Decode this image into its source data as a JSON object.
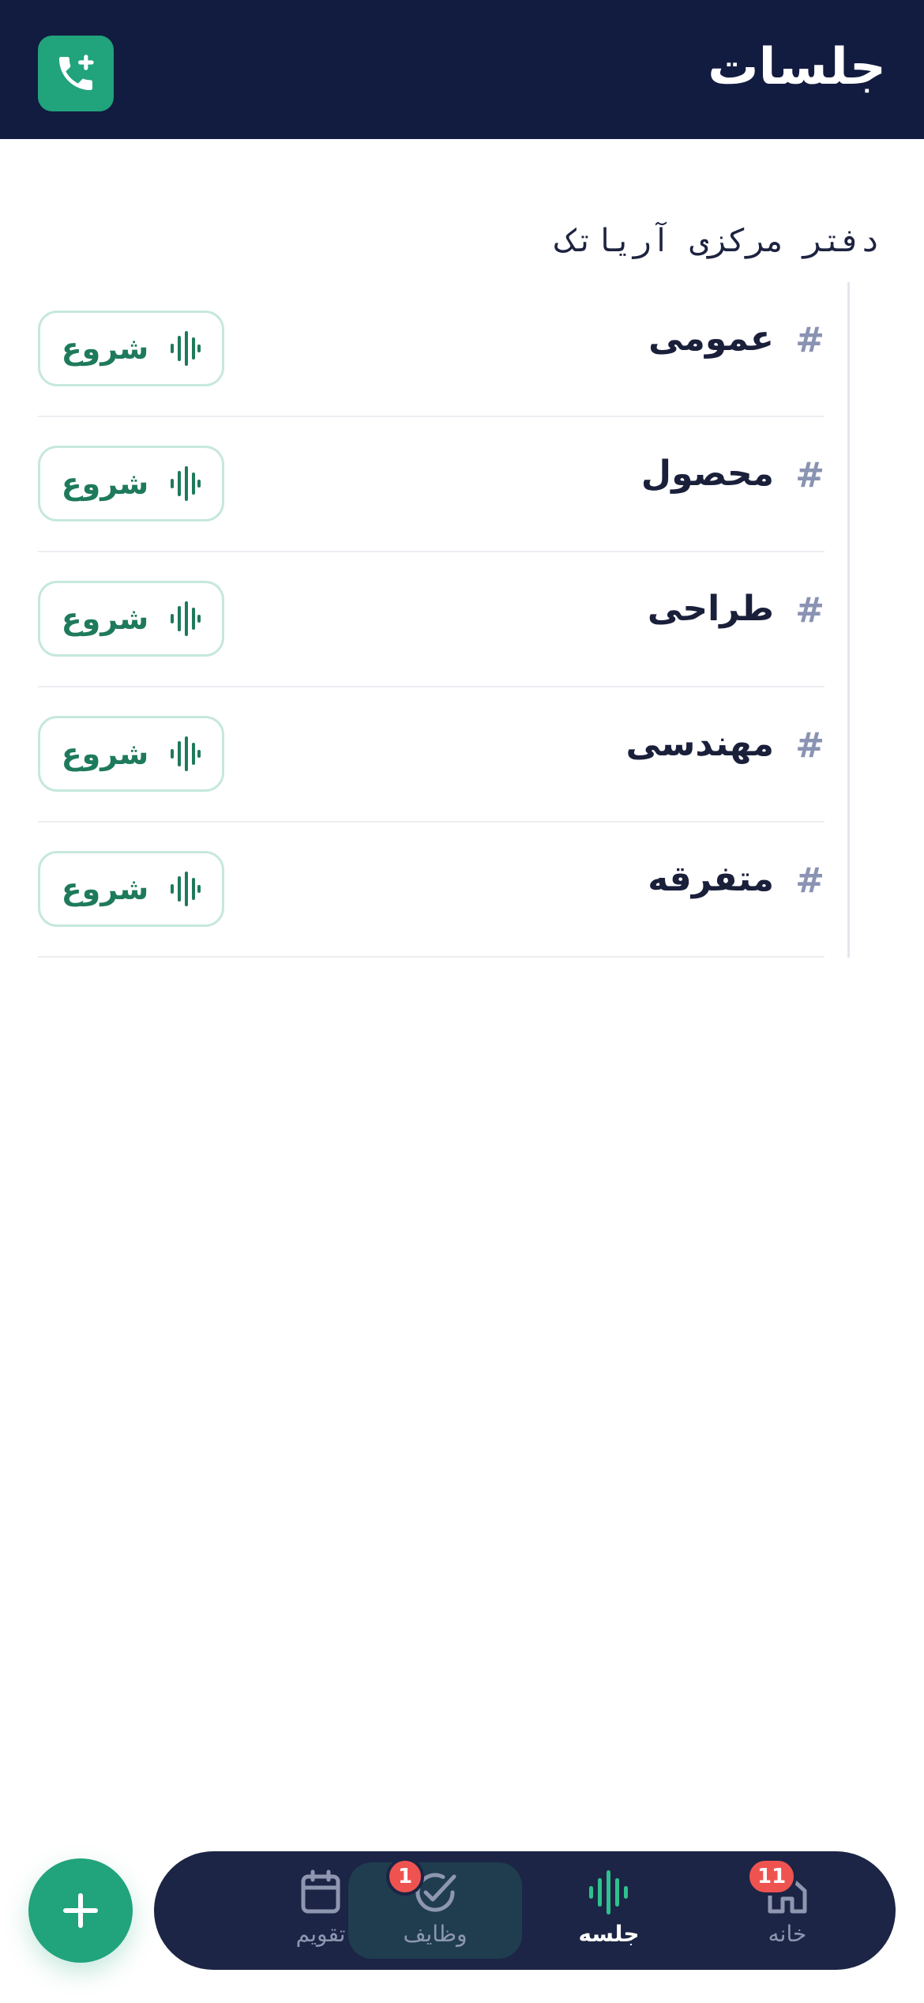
{
  "header": {
    "title": "جلسات",
    "add_call_icon": "phone-plus-icon"
  },
  "section": {
    "title": "دفتر مرکزی آریاتک"
  },
  "channels": [
    {
      "hash": "#",
      "name": "عمومی",
      "start_label": "شروع"
    },
    {
      "hash": "#",
      "name": "محصول",
      "start_label": "شروع"
    },
    {
      "hash": "#",
      "name": "طراحی",
      "start_label": "شروع"
    },
    {
      "hash": "#",
      "name": "مهندسی",
      "start_label": "شروع"
    },
    {
      "hash": "#",
      "name": "متفرقه",
      "start_label": "شروع"
    }
  ],
  "fab": {
    "icon": "plus-icon"
  },
  "bottom_nav": {
    "items": [
      {
        "key": "home",
        "label": "خانه",
        "icon": "home-icon",
        "badge": "11"
      },
      {
        "key": "meeting",
        "label": "جلسه",
        "icon": "audio-wave-icon",
        "current": true
      },
      {
        "key": "tasks",
        "label": "وظایف",
        "icon": "check-circle-icon",
        "badge": "1",
        "highlighted": true
      },
      {
        "key": "calendar",
        "label": "تقویم",
        "icon": "calendar-icon"
      }
    ]
  },
  "colors": {
    "header_bg": "#121b40",
    "accent": "#21a37b",
    "nav_bg": "#1c2545",
    "badge": "#ef5350"
  }
}
